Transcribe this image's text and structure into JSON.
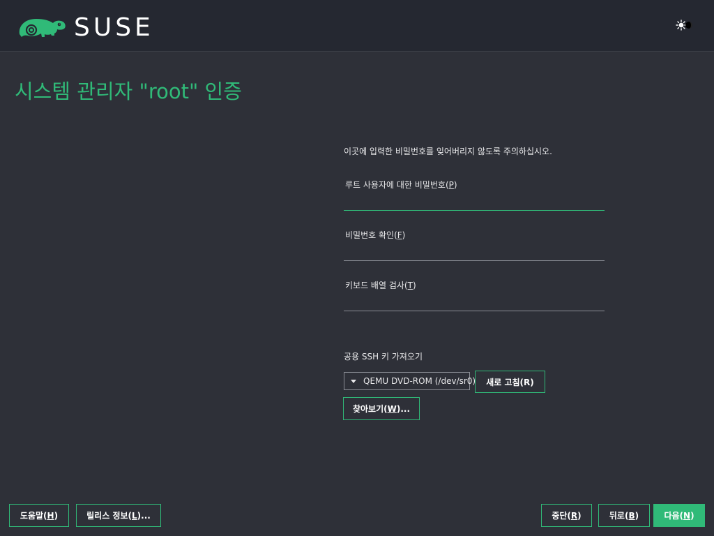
{
  "header": {
    "brand": "SUSE",
    "logo_icon": "chameleon-logo-icon",
    "theme_toggle_icon": "sun-moon-toggle-icon"
  },
  "page": {
    "title": "시스템 관리자 \"root\" 인증"
  },
  "form": {
    "warning": "이곳에 입력한 비밀번호를 잊어버리지 않도록 주의하십시오.",
    "password": {
      "label": "루트 사용자에 대한 비밀번호",
      "mnemonic": "P",
      "value": ""
    },
    "confirm": {
      "label": "비밀번호 확인",
      "mnemonic": "F",
      "value": ""
    },
    "keyboard_test": {
      "label": "키보드 배열 검사",
      "mnemonic": "T",
      "value": ""
    },
    "ssh": {
      "label": "공용 SSH 키 가져오기",
      "device_selected": "QEMU DVD-ROM (/dev/sr0)",
      "refresh_button": "새로 고침(R)",
      "browse_button_prefix": "찾아보기(",
      "browse_mnemonic": "W",
      "browse_button_suffix": ")..."
    }
  },
  "footer": {
    "help": {
      "prefix": "도움말(",
      "mnemonic": "H",
      "suffix": ")"
    },
    "release_notes": {
      "prefix": "릴리스 정보(",
      "mnemonic": "L",
      "suffix": ")..."
    },
    "abort": {
      "prefix": "중단(",
      "mnemonic": "R",
      "suffix": ")"
    },
    "back": {
      "prefix": "뒤로(",
      "mnemonic": "B",
      "suffix": ")"
    },
    "next": {
      "prefix": "다음(",
      "mnemonic": "N",
      "suffix": ")"
    }
  },
  "colors": {
    "accent": "#30ba78",
    "background": "#2e3038",
    "header_background": "#252831"
  }
}
